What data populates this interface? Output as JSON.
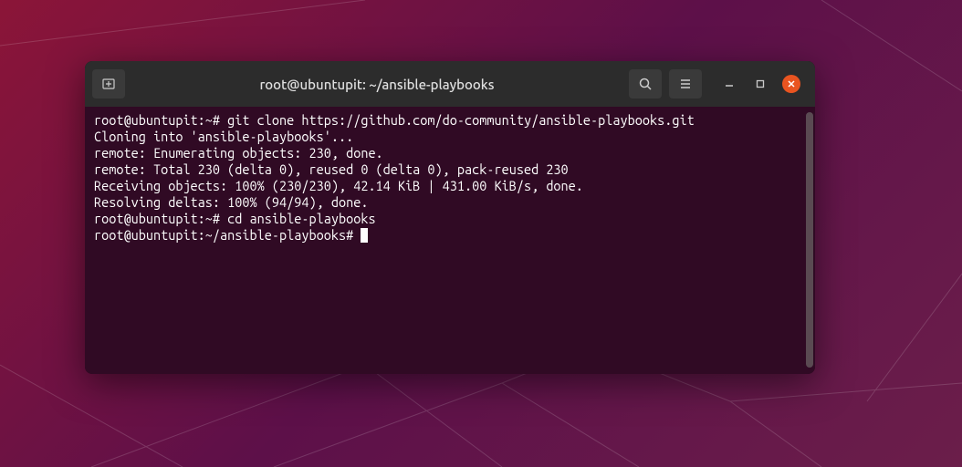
{
  "window": {
    "title": "root@ubuntupit: ~/ansible-playbooks"
  },
  "terminal": {
    "lines": [
      "root@ubuntupit:~# git clone https://github.com/do-community/ansible-playbooks.git",
      "Cloning into 'ansible-playbooks'...",
      "remote: Enumerating objects: 230, done.",
      "remote: Total 230 (delta 0), reused 0 (delta 0), pack-reused 230",
      "Receiving objects: 100% (230/230), 42.14 KiB | 431.00 KiB/s, done.",
      "Resolving deltas: 100% (94/94), done.",
      "root@ubuntupit:~# cd ansible-playbooks",
      "root@ubuntupit:~/ansible-playbooks# "
    ]
  },
  "colors": {
    "close_button": "#E95420",
    "terminal_bg": "#300A24",
    "titlebar_bg": "#2C2C2C"
  }
}
